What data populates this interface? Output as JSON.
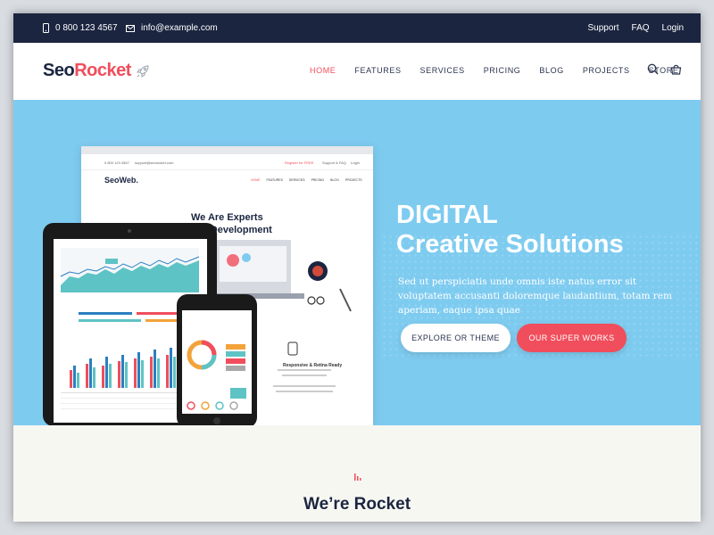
{
  "topbar": {
    "phone": "0 800 123 4567",
    "email": "info@example.com",
    "links": [
      "Support",
      "FAQ",
      "Login"
    ]
  },
  "header": {
    "logo_part1": "Seo",
    "logo_part2": "Rocket",
    "nav": [
      "HOME",
      "FEATURES",
      "SERVICES",
      "PRICING",
      "BLOG",
      "PROJECTS",
      "STORE"
    ]
  },
  "hero": {
    "title_line1": "DIGITAL",
    "title_line2": "Creative Solutions",
    "description": "Sed ut perspiciatis unde omnis iste natus error sit voluptatem accusanti doloremque laudantium, totam rem aperiam, eaque ipsa quae",
    "button_explore": "EXPLORE OR THEME",
    "button_works": "OUR SUPER WORKS"
  },
  "mockup": {
    "logo": "SeoWeb.",
    "heading_line1": "We Are Experts",
    "heading_line2": "p Development",
    "feature_title": "Responsive & Retina Ready",
    "topbar_left": "0 800 123 4567",
    "topbar_mid": "support@seorocket.com",
    "topbar_right1": "Register for FREE",
    "topbar_right2": "Support & FAQ",
    "topbar_right3": "Login",
    "nav": [
      "HOME",
      "FEATURES",
      "SERVICES",
      "PRICING",
      "BLOG",
      "PROJECTS"
    ]
  },
  "section": {
    "title": "We’re Rocket"
  },
  "colors": {
    "navy": "#1b2540",
    "accent": "#f04e5c",
    "hero_bg": "#7ecbf0"
  }
}
